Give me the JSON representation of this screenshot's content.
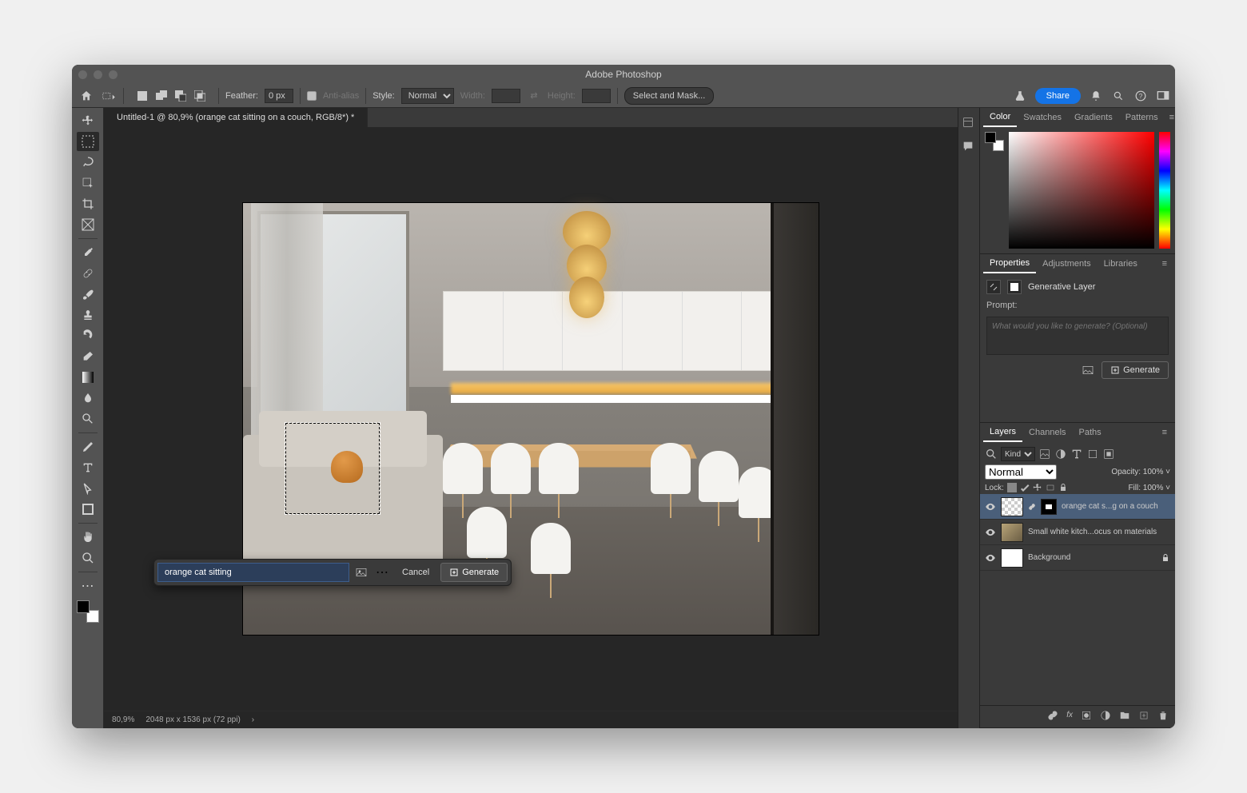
{
  "app_title": "Adobe Photoshop",
  "options_bar": {
    "feather_label": "Feather:",
    "feather_value": "0 px",
    "antialias_label": "Anti-alias",
    "style_label": "Style:",
    "style_value": "Normal",
    "width_label": "Width:",
    "height_label": "Height:",
    "select_mask_label": "Select and Mask...",
    "share_label": "Share"
  },
  "document": {
    "tab_title": "Untitled-1 @ 80,9% (orange cat sitting on a couch, RGB/8*) *",
    "zoom": "80,9%",
    "dimensions": "2048 px x 1536 px (72 ppi)"
  },
  "task_bar": {
    "prompt_value": "orange cat sitting",
    "cancel_label": "Cancel",
    "generate_label": "Generate"
  },
  "panels": {
    "color_tabs": [
      "Color",
      "Swatches",
      "Gradients",
      "Patterns"
    ],
    "props_tabs": [
      "Properties",
      "Adjustments",
      "Libraries"
    ],
    "props": {
      "layer_type_label": "Generative Layer",
      "prompt_label": "Prompt:",
      "prompt_placeholder": "What would you like to generate? (Optional)",
      "generate_label": "Generate"
    },
    "layers_tabs": [
      "Layers",
      "Channels",
      "Paths"
    ],
    "layers": {
      "kind_label": "Kind",
      "blend_mode": "Normal",
      "opacity_label": "Opacity:",
      "opacity_value": "100%",
      "lock_label": "Lock:",
      "fill_label": "Fill:",
      "fill_value": "100%",
      "items": [
        {
          "name": "orange cat s...g on a couch"
        },
        {
          "name": "Small white kitch...ocus on materials"
        },
        {
          "name": "Background"
        }
      ]
    }
  }
}
